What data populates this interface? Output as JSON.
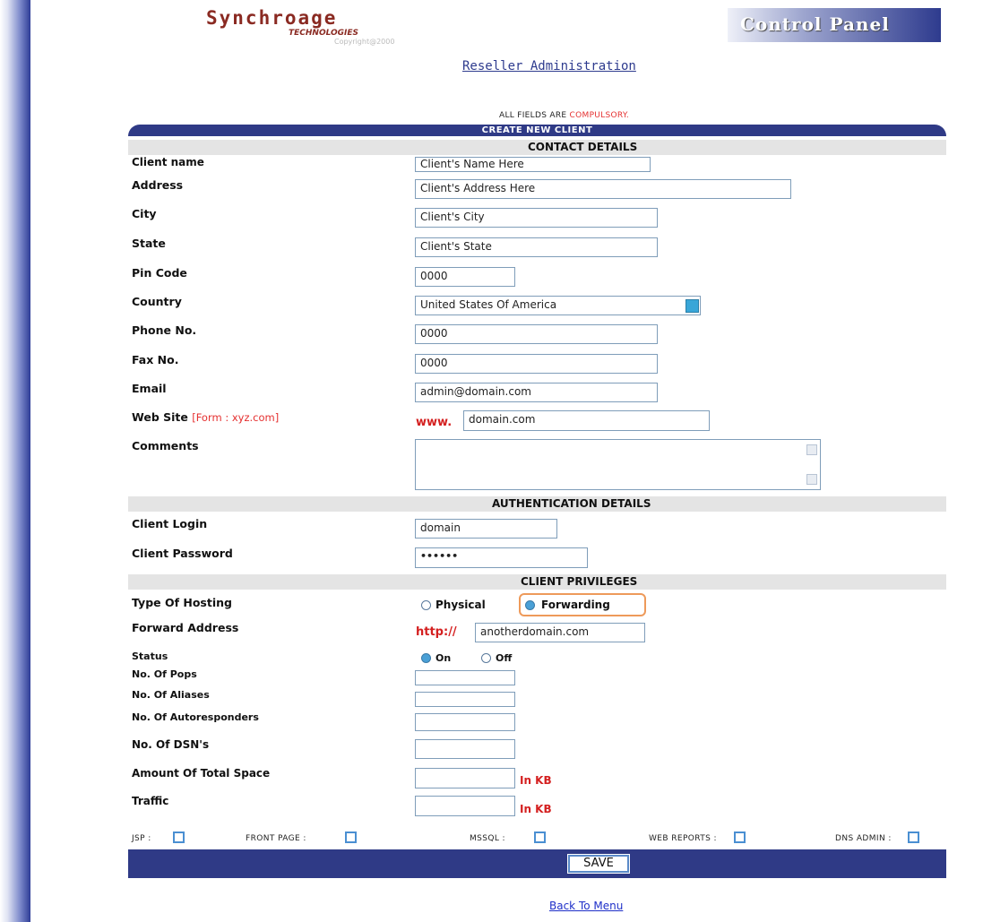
{
  "header": {
    "logo_text": "Synchroage",
    "logo_sub": "TECHNOLOGIES",
    "logo_copy": "Copyright@2000",
    "control_panel": "Control Panel",
    "subtitle": "Reseller Administration"
  },
  "notice": {
    "prefix": "ALL FIELDS ARE ",
    "highlight": "COMPULSORY."
  },
  "form": {
    "title": "CREATE NEW CLIENT",
    "sections": {
      "contact": "CONTACT DETAILS",
      "auth": "AUTHENTICATION DETAILS",
      "privileges": "CLIENT PRIVILEGES"
    },
    "contact": {
      "client_name": {
        "label": "Client name",
        "value": "Client's Name Here"
      },
      "address": {
        "label": "Address",
        "value": "Client's Address Here"
      },
      "city": {
        "label": "City",
        "value": "Client's City"
      },
      "state": {
        "label": "State",
        "value": "Client's State"
      },
      "pin": {
        "label": "Pin Code",
        "value": "0000"
      },
      "country": {
        "label": "Country",
        "value": "United States Of America"
      },
      "phone": {
        "label": "Phone No.",
        "value": "0000"
      },
      "fax": {
        "label": "Fax No.",
        "value": "0000"
      },
      "email": {
        "label": "Email",
        "value": "admin@domain.com"
      },
      "website": {
        "label": "Web Site",
        "hint": "[Form : xyz.com]",
        "prefix": "www.",
        "value": "domain.com"
      },
      "comments": {
        "label": "Comments",
        "value": ""
      }
    },
    "auth": {
      "login": {
        "label": "Client Login",
        "value": "domain"
      },
      "password": {
        "label": "Client Password",
        "value": "••••••"
      }
    },
    "privileges": {
      "hosting": {
        "label": "Type Of Hosting",
        "options": [
          "Physical",
          "Forwarding"
        ],
        "selected": "Forwarding"
      },
      "forward": {
        "label": "Forward Address",
        "prefix": "http://",
        "value": "anotherdomain.com"
      },
      "status": {
        "label": "Status",
        "options": [
          "On",
          "Off"
        ],
        "selected": "On"
      },
      "pops": {
        "label": "No. Of Pops",
        "value": ""
      },
      "aliases": {
        "label": "No. Of Aliases",
        "value": ""
      },
      "autoresponders": {
        "label": "No. Of Autoresponders",
        "value": ""
      },
      "dsn": {
        "label": "No. Of DSN's",
        "value": ""
      },
      "space": {
        "label": "Amount Of Total Space",
        "value": "",
        "unit": "In KB"
      },
      "traffic": {
        "label": "Traffic",
        "value": "",
        "unit": "In KB"
      }
    },
    "checkboxes": [
      "JSP :",
      "FRONT PAGE :",
      "MSSQL :",
      "WEB REPORTS :",
      "DNS ADMIN :"
    ],
    "save_label": "SAVE"
  },
  "back_link": "Back To Menu",
  "colors": {
    "navy": "#2f3a86",
    "accent_red": "#e53030",
    "logo_red": "#8a2a22"
  }
}
